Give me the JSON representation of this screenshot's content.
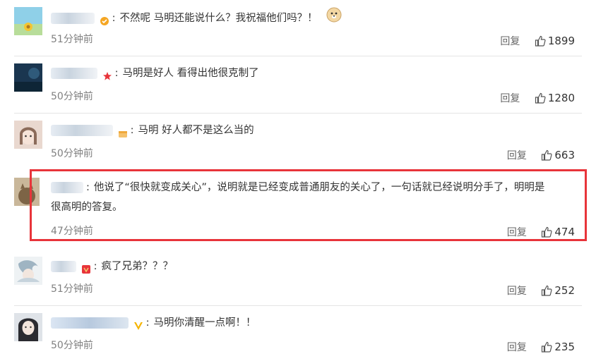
{
  "comments": [
    {
      "text": "不然呢 马明还能说什么？我祝福他们吗？！",
      "time": "51分钟前",
      "reply": "回复",
      "likes": "1899",
      "emoji": "doge-emoji"
    },
    {
      "text": "马明是好人 看得出他很克制了",
      "time": "50分钟前",
      "reply": "回复",
      "likes": "1280"
    },
    {
      "text": "马明 好人都不是这么当的",
      "time": "50分钟前",
      "reply": "回复",
      "likes": "663"
    },
    {
      "text_line1": "他说了“很快就变成关心”，说明就是已经变成普通朋友的关心了，一句话就已经说明分手了，明明是",
      "text_line2": "很高明的答复。",
      "time": "47分钟前",
      "reply": "回复",
      "likes": "474"
    },
    {
      "text": "疯了兄弟？？？",
      "time": "51分钟前",
      "reply": "回复",
      "likes": "252"
    },
    {
      "text": "马明你清醒一点啊！！",
      "time": "50分钟前",
      "reply": "回复",
      "likes": "235"
    }
  ],
  "colors": {
    "highlight": "#e8343a",
    "time": "#808080",
    "divider": "#e4e4e4"
  }
}
